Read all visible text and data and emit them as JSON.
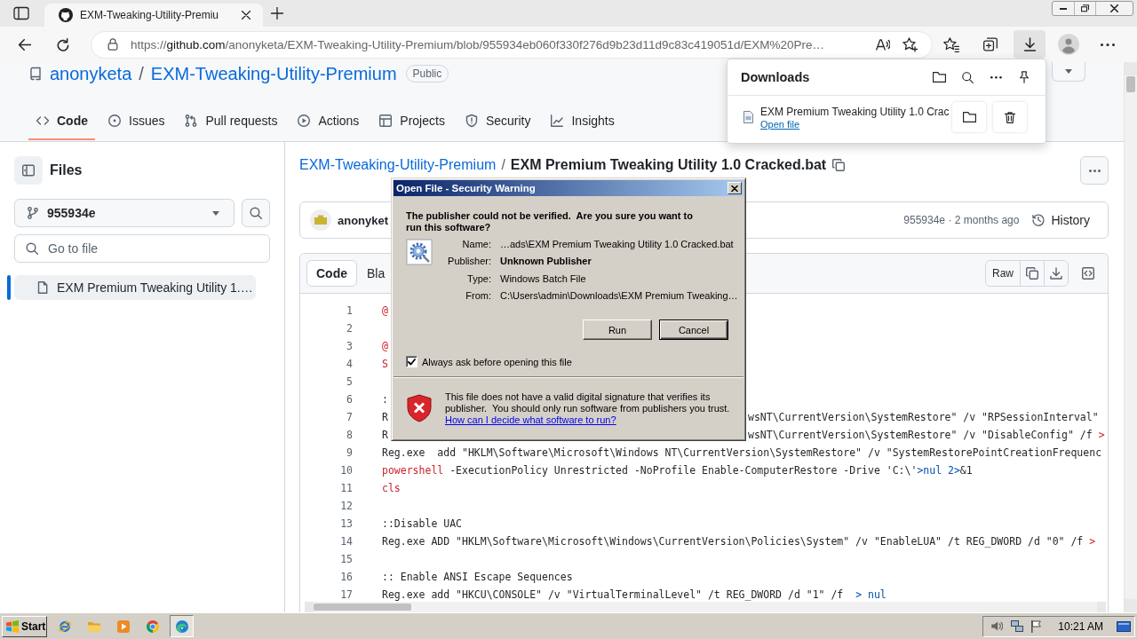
{
  "browser": {
    "tab": {
      "title": "EXM-Tweaking-Utility-Premiu"
    },
    "address": {
      "scheme": "https://",
      "host": "github.com",
      "path": "/anonyketa/EXM-Tweaking-Utility-Premium/blob/955934eb060f330f276d9b23d11d9c83c419051d/EXM%20Pre…"
    },
    "downloads_button": {
      "selected": true
    }
  },
  "repo": {
    "owner": "anonyketa",
    "separator": "/",
    "name": "EXM-Tweaking-Utility-Premium",
    "visibility": "Public"
  },
  "repo_tabs": [
    {
      "label": "Code",
      "selected": true
    },
    {
      "label": "Issues",
      "selected": false
    },
    {
      "label": "Pull requests",
      "selected": false
    },
    {
      "label": "Actions",
      "selected": false
    },
    {
      "label": "Projects",
      "selected": false
    },
    {
      "label": "Security",
      "selected": false
    },
    {
      "label": "Insights",
      "selected": false
    }
  ],
  "sidebar": {
    "title": "Files",
    "branch": "955934e",
    "search": {
      "placeholder": "Go to file"
    },
    "files": [
      {
        "name": "EXM Premium Tweaking Utility 1.…",
        "selected": true
      }
    ]
  },
  "file_view": {
    "breadcrumb": {
      "repo": "EXM-Tweaking-Utility-Premium",
      "separator": "/",
      "file": "EXM Premium Tweaking Utility 1.0 Cracked.bat"
    },
    "commit": {
      "author": "anonyket",
      "meta": "955934e · 2 months ago",
      "history": "History"
    },
    "view_tabs": [
      {
        "label": "Code",
        "selected": true
      },
      {
        "label": "Bla",
        "selected": false
      }
    ],
    "raw_button": "Raw",
    "code_lines": [
      {
        "number": "1",
        "tokens": [
          {
            "kind": "keyword",
            "text": "@"
          }
        ]
      },
      {
        "number": "2"
      },
      {
        "number": "3",
        "tokens": [
          {
            "kind": "keyword",
            "text": "@"
          }
        ]
      },
      {
        "number": "4",
        "tokens": [
          {
            "kind": "keyword",
            "text": "S"
          }
        ]
      },
      {
        "number": "5"
      },
      {
        "number": "6",
        "tokens": [
          {
            "kind": "plain",
            "text": ":"
          }
        ]
      },
      {
        "number": "7",
        "tokens": [
          {
            "kind": "plain",
            "text": "R"
          }
        ],
        "tail": [
          {
            "kind": "plain",
            "text": "wsNT\\CurrentVersion\\SystemRestore\" /v \"RPSessionInterval\""
          }
        ]
      },
      {
        "number": "8",
        "tokens": [
          {
            "kind": "plain",
            "text": "R"
          }
        ],
        "tail": [
          {
            "kind": "plain",
            "text": "wsNT\\CurrentVersion\\SystemRestore\" /v \"DisableConfig\" /f "
          },
          {
            "kind": "keyword",
            "text": ">"
          }
        ]
      },
      {
        "number": "9",
        "tokens": [
          {
            "kind": "plain",
            "text": "Reg.exe  add \"HKLM\\Software\\Microsoft\\Windows NT\\CurrentVersion\\SystemRestore\" /v \"SystemRestorePointCreationFrequenc"
          }
        ]
      },
      {
        "number": "10",
        "tokens": [
          {
            "kind": "keyword",
            "text": "powershell"
          },
          {
            "kind": "plain",
            "text": " -ExecutionPolicy Unrestricted -NoProfile Enable-ComputerRestore -Drive 'C:\\'"
          },
          {
            "kind": "redirect",
            "text": ">nul 2>"
          },
          {
            "kind": "plain",
            "text": "&1"
          }
        ]
      },
      {
        "number": "11",
        "tokens": [
          {
            "kind": "keyword",
            "text": "cls"
          }
        ]
      },
      {
        "number": "12"
      },
      {
        "number": "13",
        "tokens": [
          {
            "kind": "plain",
            "text": "::Disable UAC"
          }
        ]
      },
      {
        "number": "14",
        "tokens": [
          {
            "kind": "plain",
            "text": "Reg.exe ADD \"HKLM\\Software\\Microsoft\\Windows\\CurrentVersion\\Policies\\System\" /v \"EnableLUA\" /t REG_DWORD /d \"0\" /f "
          },
          {
            "kind": "keyword",
            "text": ">"
          }
        ]
      },
      {
        "number": "15"
      },
      {
        "number": "16",
        "tokens": [
          {
            "kind": "plain",
            "text": ":: Enable ANSI Escape Sequences"
          }
        ]
      },
      {
        "number": "17",
        "tokens": [
          {
            "kind": "plain",
            "text": "Reg.exe add \"HKCU\\CONSOLE\" /v \"VirtualTerminalLevel\" /t REG_DWORD /d \"1\" /f  "
          },
          {
            "kind": "redirect",
            "text": "> nul"
          }
        ]
      }
    ]
  },
  "downloads": {
    "title": "Downloads",
    "items": [
      {
        "name": "EXM Premium Tweaking Utility 1.0 Crac",
        "link": "Open file"
      }
    ]
  },
  "dialog": {
    "title": "Open File - Security Warning",
    "question": "The publisher could not be verified.  Are you sure you want to run this software?",
    "fields": [
      {
        "label": "Name:",
        "value": "…ads\\EXM Premium Tweaking Utility 1.0 Cracked.bat",
        "bold": false
      },
      {
        "label": "Publisher:",
        "value": "Unknown Publisher",
        "bold": true
      },
      {
        "label": "Type:",
        "value": "Windows Batch File",
        "bold": false
      },
      {
        "label": "From:",
        "value": "C:\\Users\\admin\\Downloads\\EXM Premium Tweaking…",
        "bold": false
      }
    ],
    "buttons": [
      {
        "label": "Run",
        "focused": false
      },
      {
        "label": "Cancel",
        "focused": true
      }
    ],
    "always_ask": {
      "label": "Always ask before opening this file",
      "checked": true
    },
    "warning": "This file does not have a valid digital signature that verifies its publisher.  You should only run software from publishers you trust.",
    "help_link": "How can I decide what software to run?"
  },
  "taskbar": {
    "start": "Start",
    "buttons": [
      {
        "pressed": false
      },
      {
        "pressed": false
      },
      {
        "pressed": false
      },
      {
        "pressed": false
      },
      {
        "pressed": true
      }
    ],
    "clock": "10:21 AM"
  }
}
